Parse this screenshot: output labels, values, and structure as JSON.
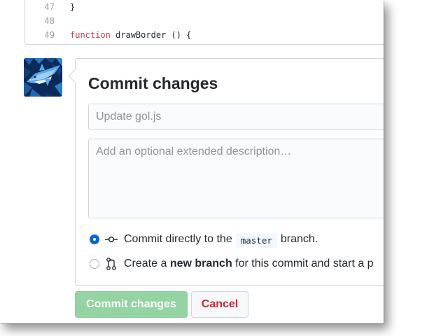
{
  "code": {
    "lines": [
      {
        "num": "47",
        "text": "}"
      },
      {
        "num": "48",
        "text": ""
      },
      {
        "num": "49",
        "keyword": "function",
        "text": " drawBorder () {"
      }
    ]
  },
  "commit": {
    "title": "Commit changes",
    "summary_placeholder": "Update gol.js",
    "description_placeholder": "Add an optional extended description…",
    "options": {
      "direct": {
        "before": "Commit directly to the",
        "branch": "master",
        "after": "branch."
      },
      "new_branch": {
        "before": "Create a ",
        "bold": "new branch",
        "after": " for this commit and start a p"
      }
    },
    "commit_button": "Commit changes",
    "cancel_button": "Cancel"
  },
  "icons": {
    "direct": "git-commit-icon",
    "new_branch": "git-pull-request-icon"
  },
  "colors": {
    "keyword": "#d73a49",
    "primary_disabled": "#94d3a2",
    "danger": "#cb2431",
    "radio_checked": "#0366d6",
    "branch_bg": "#f1f8ff"
  }
}
